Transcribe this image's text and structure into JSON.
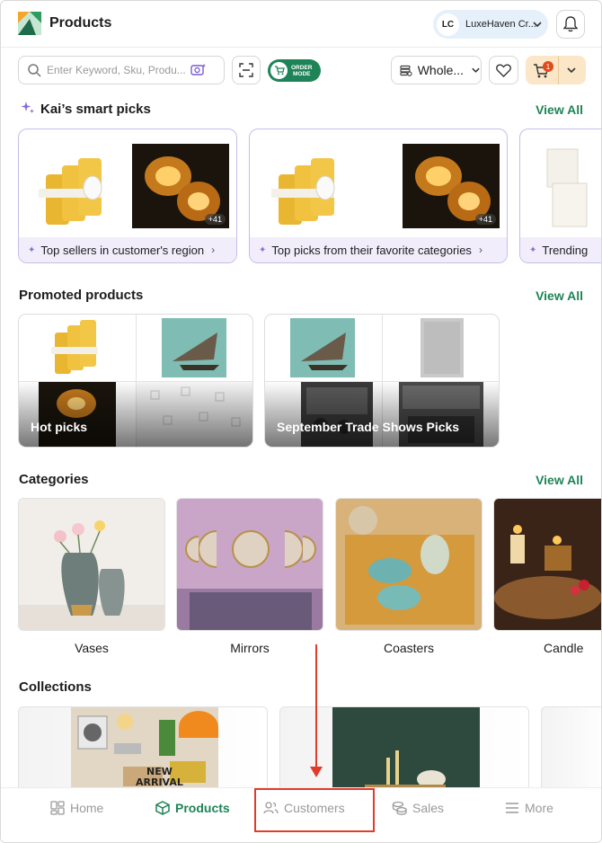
{
  "header": {
    "title": "Products",
    "store_initials": "LC",
    "store_name": "LuxeHaven Cr..."
  },
  "toolbar": {
    "search_placeholder": "Enter Keyword, Sku, Produ...",
    "order_mode_line1": "ORDER",
    "order_mode_line2": "MODE",
    "price_type": "Whole...",
    "cart_count": "1"
  },
  "smart_picks": {
    "title": "Kai’s smart picks",
    "view_all": "View All",
    "cards": [
      {
        "label": "Top sellers in customer's region",
        "more": "+41"
      },
      {
        "label": "Top picks from their favorite categories",
        "more": "+41"
      },
      {
        "label": "Trending"
      }
    ]
  },
  "promoted": {
    "title": "Promoted products",
    "view_all": "View All",
    "cards": [
      {
        "label": "Hot picks"
      },
      {
        "label": "September Trade Shows Picks"
      }
    ]
  },
  "categories": {
    "title": "Categories",
    "view_all": "View All",
    "items": [
      "Vases",
      "Mirrors",
      "Coasters",
      "Candle"
    ]
  },
  "collections": {
    "title": "Collections",
    "new_arrival_line1": "NEW",
    "new_arrival_line2": "ARRIVAL"
  },
  "bottom_nav": {
    "items": [
      "Home",
      "Products",
      "Customers",
      "Sales",
      "More"
    ],
    "active": "Products",
    "highlighted": "Customers"
  },
  "colors": {
    "accent": "#1e8457",
    "annotation": "#e23b2a",
    "smart_pick_border": "#c7bde8",
    "cart_bg": "#fbe6c8"
  }
}
